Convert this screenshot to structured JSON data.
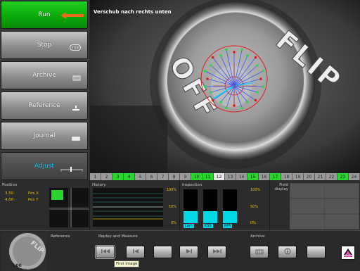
{
  "menu": {
    "run": "Run",
    "stop": "Stop",
    "archive": "Archive",
    "reference": "Reference",
    "journal": "Journal",
    "adjust": "Adjust",
    "stop_icon_text": "STOP"
  },
  "camera": {
    "title": "Verschub nach rechts unten",
    "cap_text_top": "FLIP",
    "cap_text_bottom": "OFF"
  },
  "strip": {
    "cells": [
      {
        "n": "1",
        "s": "n"
      },
      {
        "n": "2",
        "s": "n"
      },
      {
        "n": "3",
        "s": "g"
      },
      {
        "n": "4",
        "s": "g"
      },
      {
        "n": "5",
        "s": "n"
      },
      {
        "n": "6",
        "s": "n"
      },
      {
        "n": "7",
        "s": "n"
      },
      {
        "n": "8",
        "s": "n"
      },
      {
        "n": "9",
        "s": "n"
      },
      {
        "n": "10",
        "s": "g"
      },
      {
        "n": "11",
        "s": "g"
      },
      {
        "n": "12",
        "s": "w"
      },
      {
        "n": "13",
        "s": "n"
      },
      {
        "n": "14",
        "s": "n"
      },
      {
        "n": "15",
        "s": "g"
      },
      {
        "n": "16",
        "s": "n"
      },
      {
        "n": "17",
        "s": "g"
      },
      {
        "n": "18",
        "s": "n"
      },
      {
        "n": "19",
        "s": "n"
      },
      {
        "n": "20",
        "s": "n"
      },
      {
        "n": "21",
        "s": "n"
      },
      {
        "n": "22",
        "s": "n"
      },
      {
        "n": "23",
        "s": "g"
      },
      {
        "n": "24",
        "s": "n"
      }
    ]
  },
  "position": {
    "label": "Position",
    "val1": "3,50",
    "val2": "4,00",
    "pos_x": "Pos X",
    "pos_y": "Pos Y"
  },
  "history": {
    "label": "History",
    "ticks": [
      "100%",
      "50%",
      "0%"
    ]
  },
  "inspection": {
    "label": "Inspection",
    "bars": [
      "Lam",
      "KSS",
      "KPA"
    ],
    "ticks": [
      "100%",
      "50%",
      "0%"
    ]
  },
  "field_display": {
    "label": "Field display"
  },
  "bottom": {
    "reference_label": "Reference",
    "replay_label": "Replay and Measure",
    "archive_label": "Archive",
    "tooltip": "First image",
    "thumb_top": "FLIP",
    "thumb_value": "3.00",
    "thumb_bottom": "TESSA 10000"
  },
  "colors": {
    "run_green": "#0aa60a",
    "adjust_cyan": "#19c9ff",
    "strip_green": "#29d52c",
    "inspection_cyan": "#00d8e8",
    "overlay_red": "#e01b1b",
    "overlay_blue": "#3358ff"
  }
}
